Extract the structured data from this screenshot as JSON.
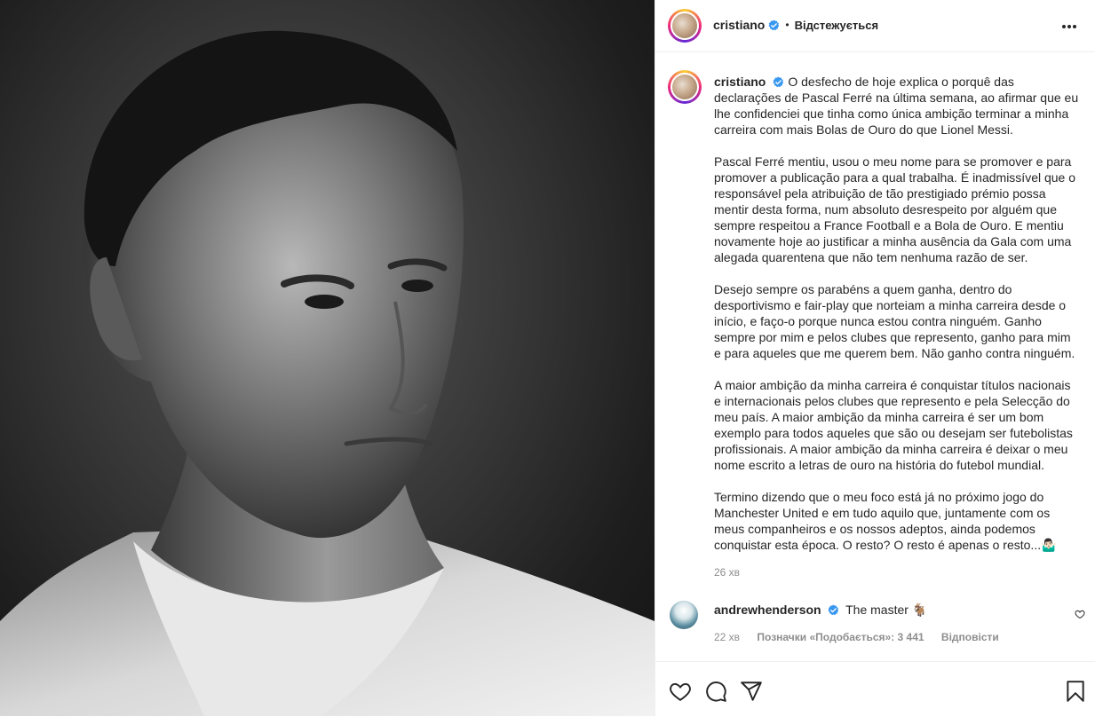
{
  "header": {
    "username": "cristiano",
    "follow_status": "Відстежується",
    "separator": "•"
  },
  "caption": {
    "username": "cristiano",
    "paragraphs": [
      "O desfecho de hoje explica o porquê das declarações de Pascal Ferré na última semana, ao afirmar que eu lhe confidenciei que tinha como única ambição terminar a minha carreira com mais Bolas de Ouro do que Lionel Messi.",
      "Pascal Ferré mentiu, usou o meu nome para se promover e para promover a publicação para a qual trabalha. É inadmissível que o responsável pela atribuição de tão prestigiado prémio possa mentir desta forma, num absoluto desrespeito por alguém que sempre respeitou a France Football e a Bola de Ouro. E mentiu novamente hoje ao justificar a minha ausência da Gala com uma alegada quarentena que não tem nenhuma razão de ser.",
      "Desejo sempre os parabéns a quem ganha, dentro do desportivismo e fair-play que norteiam a minha carreira desde o início, e faço-o porque nunca estou contra ninguém. Ganho sempre por mim e pelos clubes que represento, ganho para mim e para aqueles que me querem bem. Não ganho contra ninguém.",
      "A maior ambição da minha carreira é conquistar títulos nacionais e internacionais pelos clubes que represento e pela Selecção do meu país. A maior ambição da minha carreira é ser um bom exemplo para todos aqueles que são ou desejam ser futebolistas profissionais. A maior ambição da minha carreira é deixar o meu nome escrito a letras de ouro na história do futebol mundial.",
      "Termino dizendo que o meu foco está já no próximo jogo do Manchester United e em tudo aquilo que, juntamente com os meus companheiros e os nossos adeptos, ainda podemos conquistar esta época. O resto? O resto é apenas o resto...🤷🏻‍♂️"
    ],
    "time": "26 хв"
  },
  "comment": {
    "username": "andrewhenderson",
    "text": "The master 🐐",
    "time": "22 хв",
    "likes": "Позначки «Подобається»: 3 441",
    "reply": "Відповісти"
  },
  "icons": {
    "like": "heart-icon",
    "comment": "comment-icon",
    "share": "share-icon",
    "save": "bookmark-icon",
    "more": "more-icon",
    "verified": "verified-badge-icon"
  },
  "colors": {
    "verified": "#3897f0",
    "text": "#262626",
    "secondary": "#8e8e8e",
    "border": "#efefef"
  }
}
